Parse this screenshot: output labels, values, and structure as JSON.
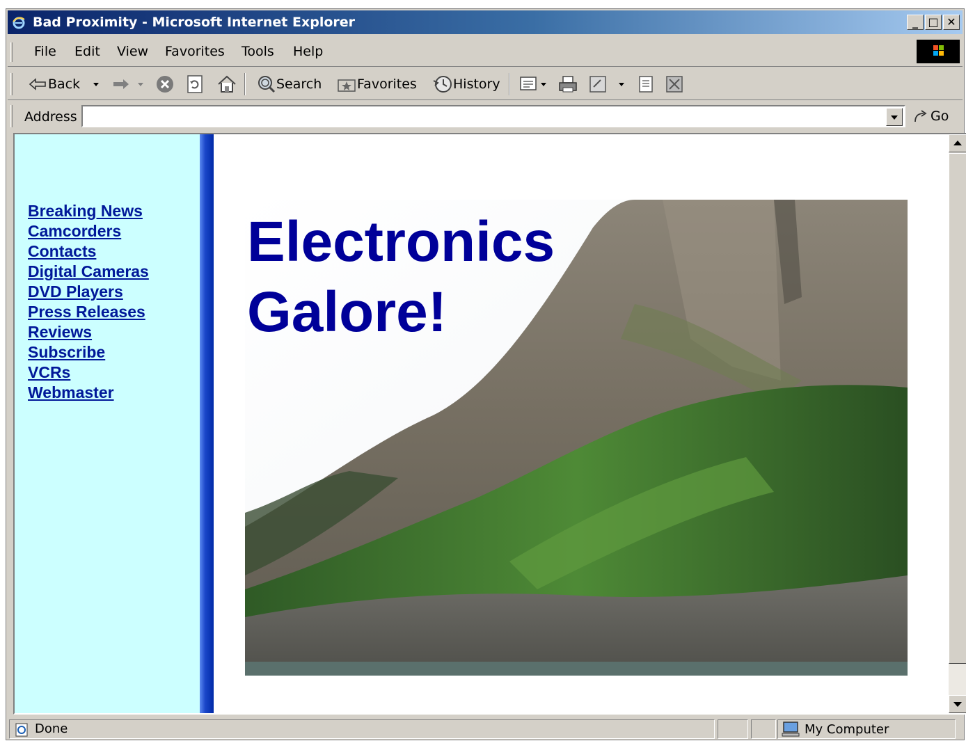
{
  "window": {
    "title": "Bad Proximity - Microsoft Internet Explorer",
    "buttons": {
      "minimize": "_",
      "maximize": "□",
      "close": "✕"
    }
  },
  "menu": [
    "File",
    "Edit",
    "View",
    "Favorites",
    "Tools",
    "Help"
  ],
  "toolbar": {
    "back_label": "Back",
    "search_label": "Search",
    "favorites_label": "Favorites",
    "history_label": "History"
  },
  "address": {
    "label": "Address",
    "value": "",
    "go_label": "Go"
  },
  "page": {
    "sidebar_color": "#ccffff",
    "link_color": "#001899",
    "headline_color": "#000099",
    "nav_links": [
      "Breaking News",
      "Camcorders",
      "Contacts",
      "Digital Cameras",
      "DVD Players",
      "Press Releases",
      "Reviews",
      "Subscribe",
      "VCRs",
      "Webmaster"
    ],
    "headline_line1": "Electronics",
    "headline_line2": "Galore!"
  },
  "status": {
    "text": "Done",
    "zone": "My Computer"
  },
  "icons": [
    "ie-icon",
    "windows-logo-icon",
    "back-arrow-icon",
    "forward-arrow-icon",
    "stop-icon",
    "refresh-icon",
    "home-icon",
    "search-icon",
    "favorites-icon",
    "history-icon",
    "mail-icon",
    "print-icon",
    "edit-icon",
    "discuss-icon",
    "messenger-icon",
    "go-arrow-icon",
    "computer-icon",
    "page-icon"
  ]
}
